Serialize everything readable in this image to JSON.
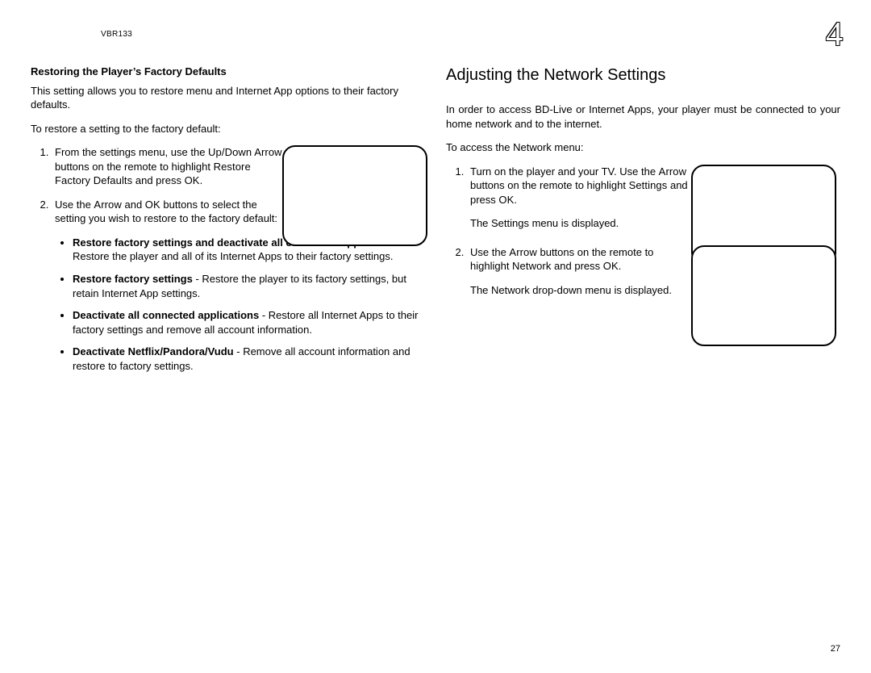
{
  "header": {
    "model": "VBR133",
    "chapter_number": "4"
  },
  "left": {
    "heading": "Restoring the Player’s Factory Defaults",
    "intro": "This setting allows you to restore menu and Internet App options to their factory defaults.",
    "lead_in": "To restore a setting to the factory default:",
    "steps": {
      "s1": {
        "pre1": "From the settings menu, use the ",
        "kw1": "Up/Down Arrow",
        "mid1": " buttons on the remote to highlight ",
        "kw2": "Restore Factory Defaults",
        "mid2": " and press ",
        "kw3": "OK",
        "post": "."
      },
      "s2": {
        "pre1": "Use the ",
        "kw1": "Arrow",
        "mid1": " and ",
        "kw2": "OK",
        "post": " buttons to select the setting you wish to restore to the factory default:"
      }
    },
    "bullets": {
      "b1": {
        "bold": "Restore factory settings and deactivate all connected applications",
        "rest": " - Restore the player and all of its Internet Apps to their factory settings."
      },
      "b2": {
        "bold": "Restore factory settings",
        "rest": " - Restore the player to its factory settings, but retain Internet App settings."
      },
      "b3": {
        "bold": "Deactivate all connected applications",
        "rest": " - Restore all Internet Apps to their factory settings and remove all account information."
      },
      "b4": {
        "bold": "Deactivate Netflix/Pandora/Vudu",
        "rest": " - Remove all account information and restore to factory settings."
      }
    }
  },
  "right": {
    "heading": "Adjusting the Network Settings",
    "intro": "In order to access BD-Live or Internet Apps, your player must be connected to your home network and to the internet.",
    "lead_in": "To access the Network menu:",
    "steps": {
      "s1": {
        "pre1": "Turn on the player and your TV. Use the ",
        "kw1": "Arrow",
        "mid1": " buttons on the remote to highlight ",
        "kw2": "Settings",
        "mid2": " and press ",
        "kw3": "OK",
        "post": ".",
        "result": "The Settings menu is displayed."
      },
      "s2": {
        "pre1": "Use the ",
        "kw1": "Arrow",
        "mid1": " buttons on the remote to highlight ",
        "kw2": "Network",
        "mid2": " and press ",
        "kw3": "OK",
        "post": ".",
        "result": "The Network drop-down menu is displayed."
      }
    }
  },
  "page_number": "27"
}
